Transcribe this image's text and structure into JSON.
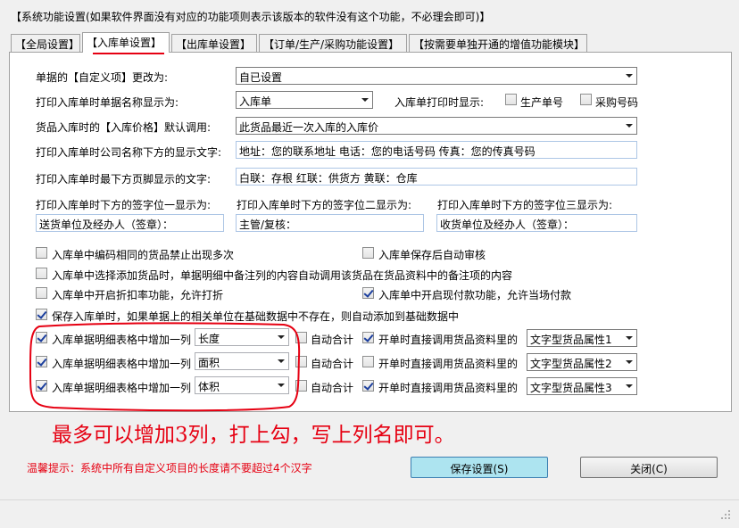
{
  "window": {
    "title": "【系统功能设置(如果软件界面没有对应的功能项则表示该版本的软件没有这个功能，不必理会即可)】"
  },
  "tabs": [
    {
      "label": "【全局设置】",
      "active": false
    },
    {
      "label": "【入库单设置】",
      "active": true
    },
    {
      "label": "【出库单设置】",
      "active": false
    },
    {
      "label": "【订单/生产/采购功能设置】",
      "active": false
    },
    {
      "label": "【按需要单独开通的增值功能模块】",
      "active": false
    }
  ],
  "form": {
    "custom_item": {
      "label": "单据的【自定义项】更改为:",
      "value": "自已设置"
    },
    "print_title": {
      "label": "打印入库单时单据名称显示为:",
      "value": "入库单"
    },
    "print_show": {
      "label": "入库单打印时显示:",
      "production_no": {
        "label": "生产单号",
        "checked": false
      },
      "purchase_no": {
        "label": "采购号码",
        "checked": false
      }
    },
    "price": {
      "label": "货品入库时的【入库价格】默认调用:",
      "value": "此货品最近一次入库的入库价"
    },
    "company_text": {
      "label": "打印入库单时公司名称下方的显示文字:",
      "value": "地址：您的联系地址 电话：您的电话号码 传真：您的传真号码"
    },
    "footer_text": {
      "label": "打印入库单时最下方页脚显示的文字:",
      "value": "白联：存根   红联：供货方   黄联：仓库"
    },
    "sign1": {
      "label": "打印入库单时下方的签字位一显示为:",
      "value": "送货单位及经办人（签章）："
    },
    "sign2": {
      "label": "打印入库单时下方的签字位二显示为:",
      "value": "主管/复核："
    },
    "sign3": {
      "label": "打印入库单时下方的签字位三显示为:",
      "value": "收货单位及经办人（签章）："
    }
  },
  "options": {
    "dup_code": {
      "label": "入库单中编码相同的货品禁止出现多次",
      "checked": false
    },
    "auto_audit": {
      "label": "入库单保存后自动审核",
      "checked": false
    },
    "select_note": {
      "label": "入库单中选择添加货品时，单据明细中备注列的内容自动调用该货品在货品资料中的备注项的内容",
      "checked": false
    },
    "discount": {
      "label": "入库单中开启折扣率功能，允许打折",
      "checked": false
    },
    "cash_pay": {
      "label": "入库单中开启现付款功能，允许当场付款",
      "checked": true
    },
    "auto_add_unit": {
      "label": "保存入库单时，如果单据上的相关单位在基础数据中不存在，则自动添加到基础数据中",
      "checked": true
    }
  },
  "extra_columns": [
    {
      "checked": true,
      "label": "入库单据明细表格中增加一列",
      "name": "长度",
      "auto_sum_label": "自动合计",
      "auto_sum": false,
      "fetch_label": "开单时直接调用货品资料里的",
      "fetch": true,
      "attr": "文字型货品属性1"
    },
    {
      "checked": true,
      "label": "入库单据明细表格中增加一列",
      "name": "面积",
      "auto_sum_label": "自动合计",
      "auto_sum": false,
      "fetch_label": "开单时直接调用货品资料里的",
      "fetch": false,
      "attr": "文字型货品属性2"
    },
    {
      "checked": true,
      "label": "入库单据明细表格中增加一列",
      "name": "体积",
      "auto_sum_label": "自动合计",
      "auto_sum": false,
      "fetch_label": "开单时直接调用货品资料里的",
      "fetch": true,
      "attr": "文字型货品属性3"
    }
  ],
  "annotation": "最多可以增加3列，打上勾，写上列名即可。",
  "footer": {
    "hint": "温馨提示：系统中所有自定义项目的长度请不要超过4个汉字",
    "save_label": "保存设置(S)",
    "close_label": "关闭(C)"
  },
  "colors": {
    "annotation": "#e60012",
    "primary_button": "#ade4f0"
  }
}
